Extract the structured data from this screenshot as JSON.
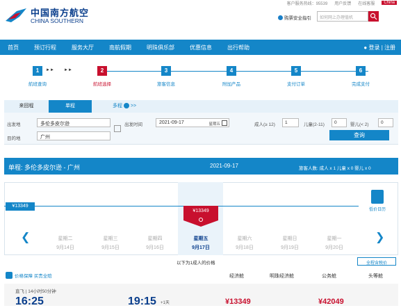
{
  "top_strip": {
    "hotline": "客户服务热线：95539",
    "feedback": "用户反馈",
    "online": "在线客服",
    "region": "China"
  },
  "brand": {
    "cn": "中国南方航空",
    "en": "CHINA SOUTHERN"
  },
  "security_tip": "购票安全指引",
  "search": {
    "placeholder": "如何网上办理值机"
  },
  "nav": {
    "items": [
      "首页",
      "预订行程",
      "服务大厅",
      "南航假期",
      "明珠俱乐部",
      "优惠信息",
      "出行帮助"
    ],
    "login": "登录 | 注册"
  },
  "steps": [
    {
      "num": "1",
      "label": "航班查询"
    },
    {
      "num": "2",
      "label": "航班选择"
    },
    {
      "num": "3",
      "label": "旅客信息"
    },
    {
      "num": "4",
      "label": "附加产品"
    },
    {
      "num": "5",
      "label": "支付订单"
    },
    {
      "num": "6",
      "label": "完成支付"
    }
  ],
  "trip_tabs": {
    "round": "来回程",
    "oneway": "单程",
    "multi": "多程",
    "multi_arrow": ">>"
  },
  "form": {
    "from_label": "出发地",
    "from_value": "多伦多皮尔逊",
    "to_label": "目的地",
    "to_value": "广州",
    "date_label": "出发时间",
    "date_value": "2021-09-17",
    "date_weekday": "星期五",
    "adult_label": "成人(≥ 12)",
    "adult_value": "1",
    "child_label": "儿童(2-11)",
    "child_value": "0",
    "infant_label": "婴儿(< 2)",
    "infant_value": "0",
    "query_button": "查询"
  },
  "banner": {
    "title": "单程:   多伦多皮尔逊  -  广州",
    "date": "2021-09-17",
    "passengers": "旅客人数:  成人 x 1    儿童 x 0    婴儿 x 0"
  },
  "calendar": {
    "min_price": "¥13349",
    "selected_price": "¥13349",
    "calendar_label": "低价日历",
    "days": [
      {
        "weekday": "星期二",
        "date": "9月14日"
      },
      {
        "weekday": "星期三",
        "date": "9月15日"
      },
      {
        "weekday": "星期四",
        "date": "9月16日"
      },
      {
        "weekday": "星期五",
        "date": "9月17日"
      },
      {
        "weekday": "星期六",
        "date": "9月18日"
      },
      {
        "weekday": "星期日",
        "date": "9月19日"
      },
      {
        "weekday": "星期一",
        "date": "9月20日"
      }
    ]
  },
  "price_note": "以下为1成人的价格",
  "all_price": "全程含税价",
  "guarantee": "价格保障  买贵全赔",
  "columns": [
    "经济舱",
    "明珠经济舱",
    "公务舱",
    "头等舱"
  ],
  "flight": {
    "route": "直飞  |  14小时50分钟",
    "depart": "16:25",
    "arrive": "19:15",
    "plus_day": "+1天",
    "economy_price": "¥13349",
    "business_price": "¥42049"
  }
}
